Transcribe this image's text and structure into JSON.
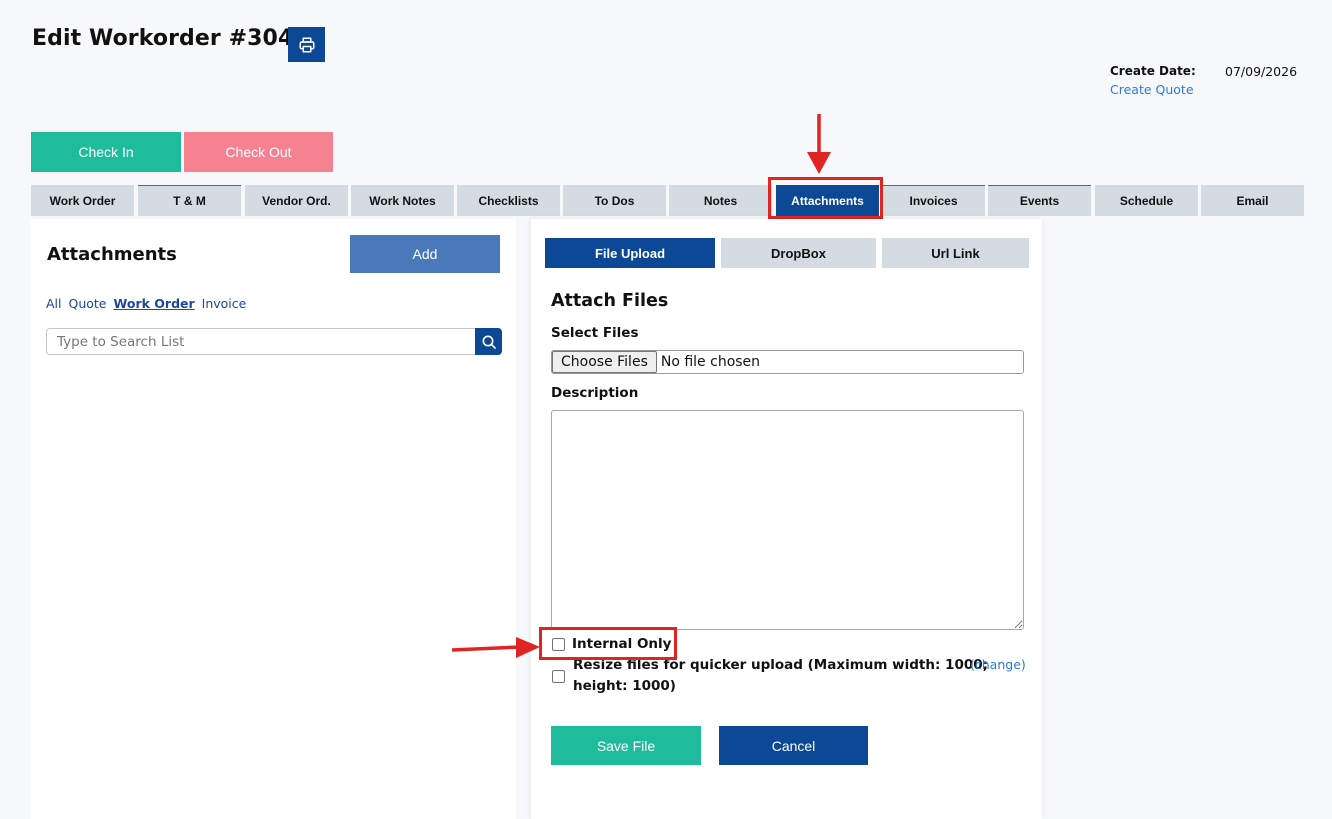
{
  "header": {
    "title": "Edit Workorder #3043",
    "print_icon": "printer-icon",
    "create_date_label": "Create Date:",
    "create_date_value": "07/09/2026",
    "create_quote_link": "Create Quote"
  },
  "actions": {
    "check_in": "Check In",
    "check_out": "Check Out"
  },
  "tabs": [
    {
      "label": "Work Order"
    },
    {
      "label": "T & M"
    },
    {
      "label": "Vendor Ord."
    },
    {
      "label": "Work Notes"
    },
    {
      "label": "Checklists"
    },
    {
      "label": "To Dos"
    },
    {
      "label": "Notes"
    },
    {
      "label": "Attachments",
      "active": true
    },
    {
      "label": "Invoices"
    },
    {
      "label": "Events"
    },
    {
      "label": "Schedule"
    },
    {
      "label": "Email"
    }
  ],
  "attachments_panel": {
    "title": "Attachments",
    "add_label": "Add",
    "filters": [
      "All",
      "Quote",
      "Work Order",
      "Invoice"
    ],
    "selected_filter": "Work Order",
    "search_placeholder": "Type to Search List",
    "search_icon": "search-icon"
  },
  "upload_panel": {
    "subtabs": [
      "File Upload",
      "DropBox",
      "Url Link"
    ],
    "active_subtab": "File Upload",
    "title": "Attach Files",
    "select_files_label": "Select Files",
    "choose_files_label": "Choose Files",
    "no_file_text": "No file chosen",
    "description_label": "Description",
    "internal_only_label": "Internal Only",
    "resize_label_line1": "Resize files for quicker upload (Maximum width: 1000;",
    "resize_label_line2": "height: 1000)",
    "change_link": "(change)",
    "save_label": "Save File",
    "cancel_label": "Cancel"
  },
  "annotations": {
    "color": "#e02424"
  }
}
